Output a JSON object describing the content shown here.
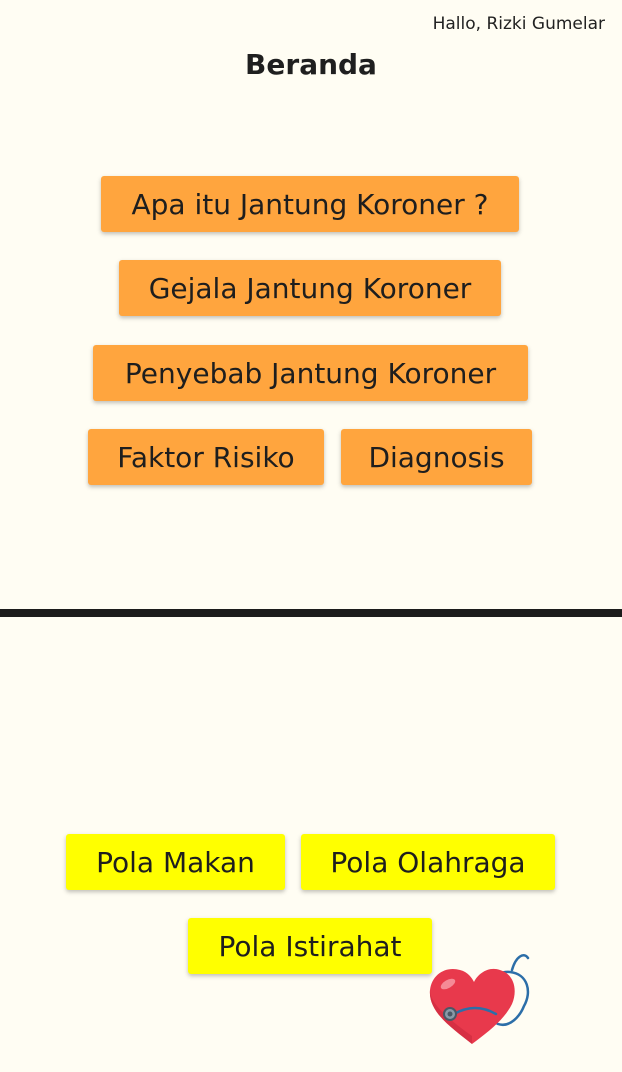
{
  "header": {
    "greeting": "Hallo, Rizki Gumelar",
    "title": "Beranda"
  },
  "info_menu": {
    "apa_itu": "Apa itu Jantung Koroner ?",
    "gejala": "Gejala Jantung Koroner",
    "penyebab": "Penyebab Jantung Koroner",
    "faktor_risiko": "Faktor Risiko",
    "diagnosis": "Diagnosis"
  },
  "pola_menu": {
    "makan": "Pola Makan",
    "olahraga": "Pola Olahraga",
    "istirahat": "Pola Istirahat"
  },
  "illustration": {
    "icon": "heart-stethoscope-icon"
  },
  "colors": {
    "background": "#fffdf3",
    "orange_button": "#ffa53e",
    "yellow_button": "#ffff00",
    "divider": "#1c1c1c",
    "heart": "#e8394c"
  }
}
